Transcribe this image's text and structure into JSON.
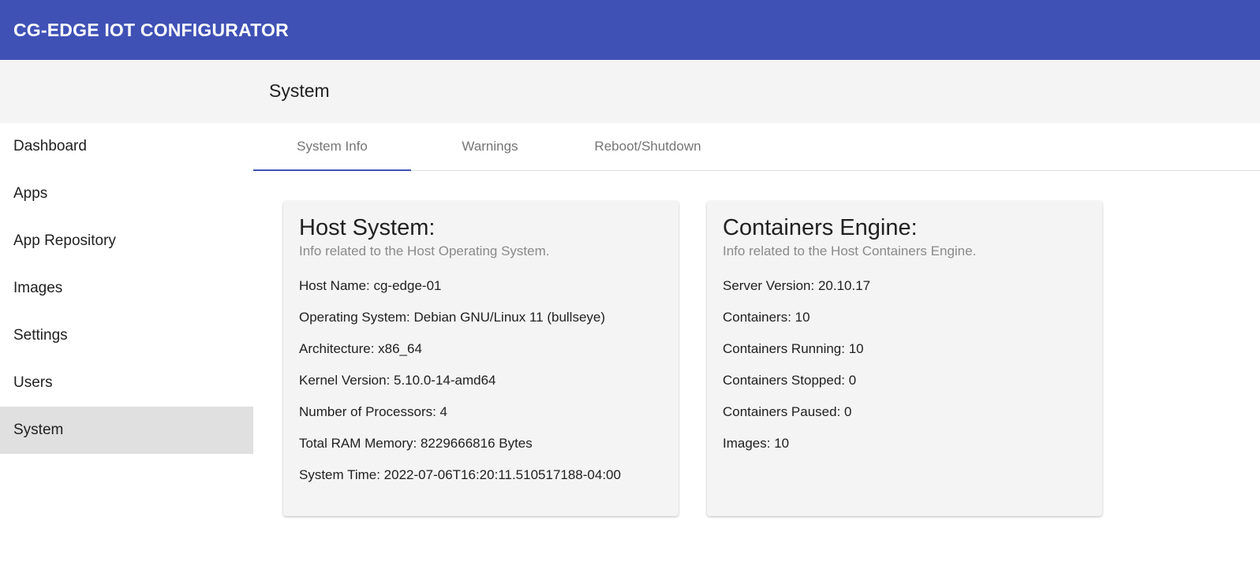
{
  "app": {
    "title": "CG-EDGE IOT CONFIGURATOR",
    "colors": {
      "app_bar": "#3f51b5",
      "active_tab_indicator": "#3f51b5",
      "active_sidebar": "#e0e0e0"
    }
  },
  "header": {
    "page_title": "System"
  },
  "sidebar": {
    "items": [
      {
        "label": "Dashboard",
        "active": false
      },
      {
        "label": "Apps",
        "active": false
      },
      {
        "label": "App Repository",
        "active": false
      },
      {
        "label": "Images",
        "active": false
      },
      {
        "label": "Settings",
        "active": false
      },
      {
        "label": "Users",
        "active": false
      },
      {
        "label": "System",
        "active": true
      }
    ]
  },
  "tabs": [
    {
      "label": "System Info",
      "active": true
    },
    {
      "label": "Warnings",
      "active": false
    },
    {
      "label": "Reboot/Shutdown",
      "active": false
    }
  ],
  "host_card": {
    "title": "Host System:",
    "subtitle": "Info related to the Host Operating System.",
    "lines": [
      "Host Name: cg-edge-01",
      "Operating System: Debian GNU/Linux 11 (bullseye)",
      "Architecture: x86_64",
      "Kernel Version: 5.10.0-14-amd64",
      "Number of Processors: 4",
      "Total RAM Memory: 8229666816 Bytes",
      "System Time: 2022-07-06T16:20:11.510517188-04:00"
    ]
  },
  "engine_card": {
    "title": "Containers Engine:",
    "subtitle": "Info related to the Host Containers Engine.",
    "lines": [
      "Server Version: 20.10.17",
      "Containers: 10",
      "Containers Running: 10",
      "Containers Stopped: 0",
      "Containers Paused: 0",
      "Images: 10"
    ]
  }
}
